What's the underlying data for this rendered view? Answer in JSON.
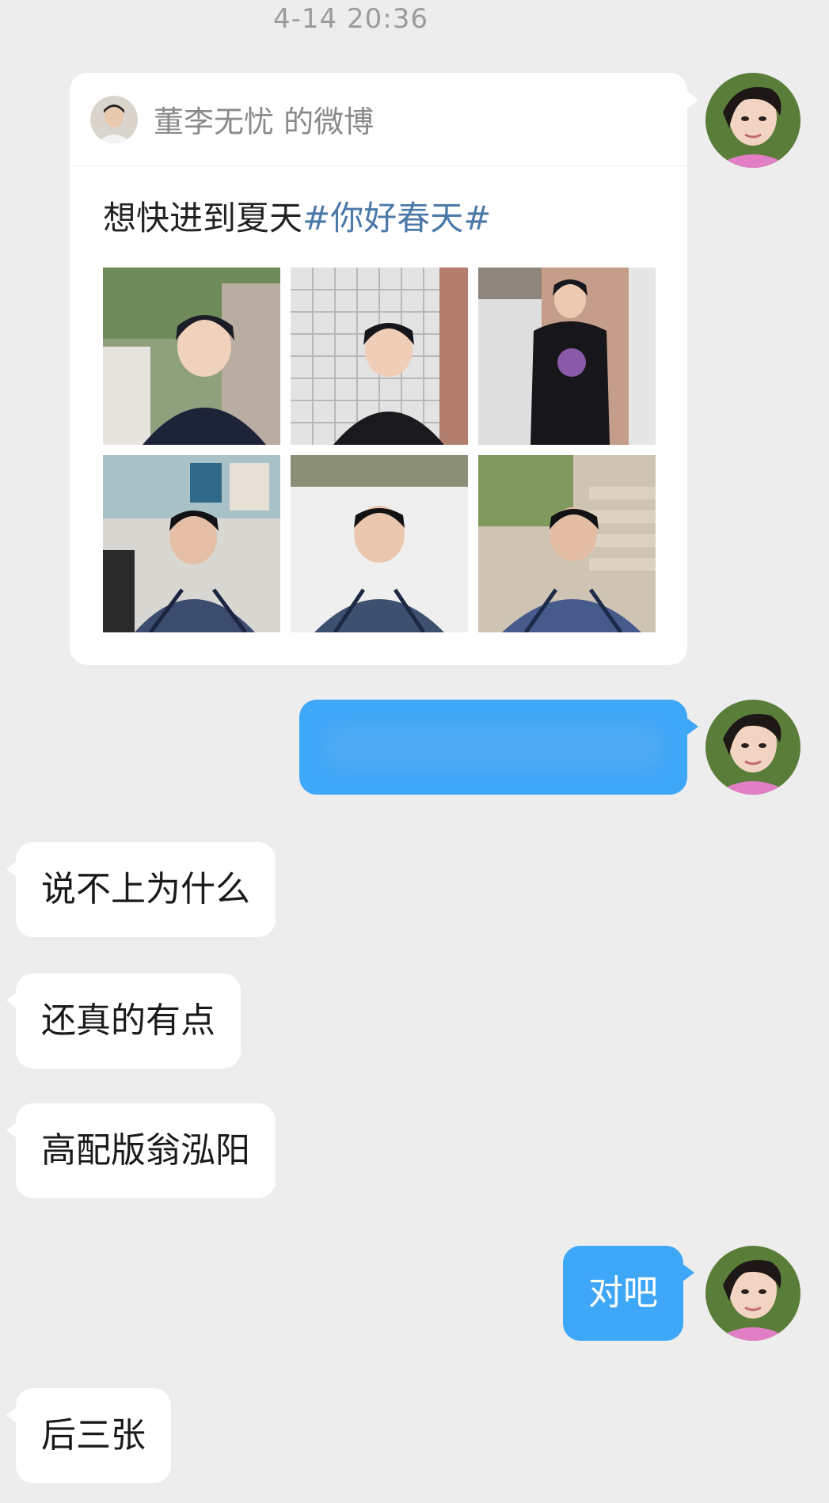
{
  "timestamp": "4-14 20:36",
  "weibo_card": {
    "author": "董李无忧 的微博",
    "text": "想快进到夏天",
    "topic": "#你好春天#",
    "photo_count": 6
  },
  "messages": [
    {
      "side": "right",
      "text": ""
    },
    {
      "side": "left",
      "text": "说不上为什么"
    },
    {
      "side": "left",
      "text": "还真的有点"
    },
    {
      "side": "left",
      "text": "高配版翁泓阳"
    },
    {
      "side": "right",
      "text": "对吧"
    },
    {
      "side": "left",
      "text": "后三张"
    }
  ],
  "colors": {
    "background": "#ededed",
    "right_bubble": "#3fa7f7",
    "left_bubble": "#ffffff",
    "topic": "#4c79a8"
  },
  "icons": {
    "self_avatar": "avatar-photo",
    "author_avatar": "avatar-photo"
  }
}
